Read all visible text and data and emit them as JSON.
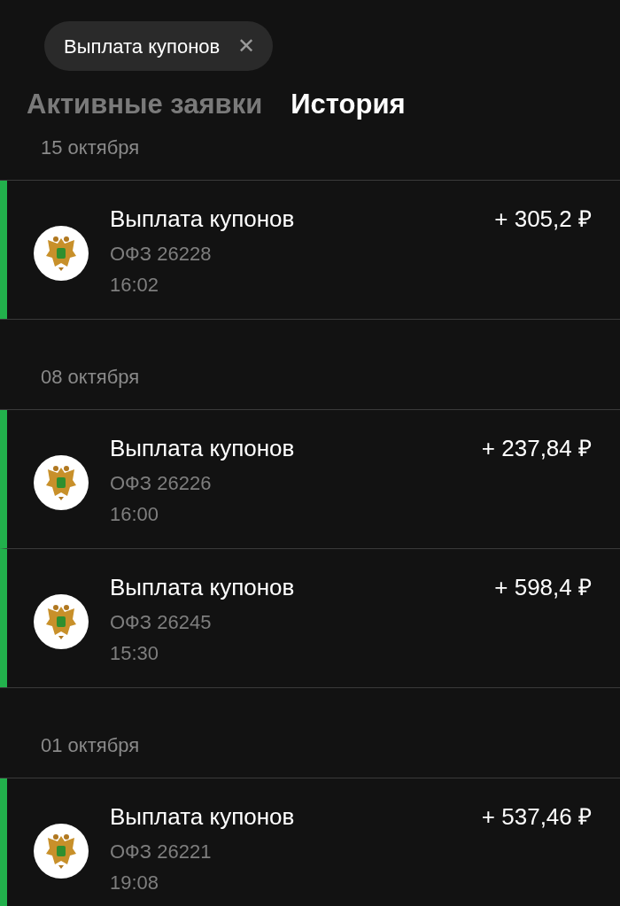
{
  "filter_chip": {
    "label": "Выплата купонов",
    "close": "✕"
  },
  "tabs": [
    {
      "label": "Активные заявки",
      "selected": false
    },
    {
      "label": "История",
      "selected": true
    }
  ],
  "groups": [
    {
      "date": "15 октября",
      "operations": [
        {
          "title": "Выплата купонов",
          "security": "ОФЗ 26228",
          "time": "16:02",
          "amount": "+ 305,2 ₽"
        }
      ]
    },
    {
      "date": "08 октября",
      "operations": [
        {
          "title": "Выплата купонов",
          "security": "ОФЗ 26226",
          "time": "16:00",
          "amount": "+ 237,84 ₽"
        },
        {
          "title": "Выплата купонов",
          "security": "ОФЗ 26245",
          "time": "15:30",
          "amount": "+ 598,4 ₽"
        }
      ]
    },
    {
      "date": "01 октября",
      "operations": [
        {
          "title": "Выплата купонов",
          "security": "ОФЗ 26221",
          "time": "19:08",
          "amount": "+ 537,46 ₽"
        }
      ]
    }
  ]
}
